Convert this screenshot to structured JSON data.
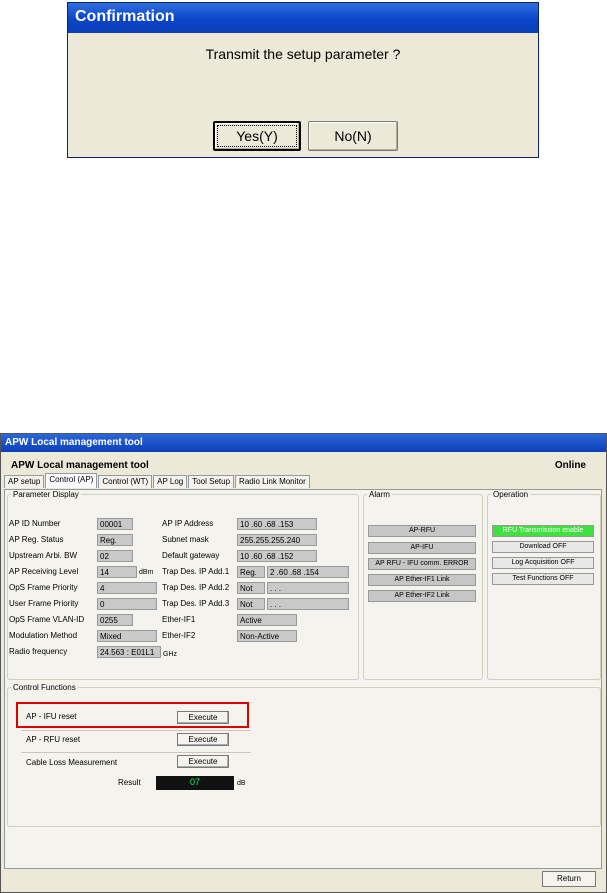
{
  "dialog": {
    "title": "Confirmation",
    "message": "Transmit the setup parameter ?",
    "yes_label": "Yes(Y)",
    "no_label": "No(N)"
  },
  "window": {
    "title": "APW Local management tool",
    "app_title": "APW Local management tool",
    "status": "Online"
  },
  "tabs": [
    "AP setup",
    "Control (AP)",
    "Control (WT)",
    "AP Log",
    "Tool Setup",
    "Radio Link Monitor"
  ],
  "param": {
    "legend": "Parameter Display",
    "left": [
      {
        "label": "AP ID Number",
        "value": "00001"
      },
      {
        "label": "AP Reg. Status",
        "value": "Reg."
      },
      {
        "label": "Upstream Arbi. BW",
        "value": "02"
      },
      {
        "label": "AP Receiving Level",
        "value": "14",
        "unit": "dBm"
      },
      {
        "label": "OpS Frame Priority",
        "value": "4"
      },
      {
        "label": "User Frame Priority",
        "value": "0"
      },
      {
        "label": "OpS Frame VLAN-ID",
        "value": "0255"
      },
      {
        "label": "Modulation Method",
        "value": "Mixed"
      },
      {
        "label": "Radio frequency",
        "value": "24.563 : E01L1",
        "unit": "GHz"
      }
    ],
    "right": [
      {
        "label": "AP IP Address",
        "value": "10 .60 .68 .153"
      },
      {
        "label": "Subnet mask",
        "value": "255.255.255.240"
      },
      {
        "label": "Default gateway",
        "value": "10 .60 .68 .152"
      },
      {
        "label": "Trap Des. IP Add.1",
        "value": "Reg.",
        "value2": "2 .60 .68 .154"
      },
      {
        "label": "Trap Des. IP Add.2",
        "value": "Not",
        "value2": ". . ."
      },
      {
        "label": "Trap Des. IP Add.3",
        "value": "Not",
        "value2": ". . ."
      },
      {
        "label": "Ether-IF1",
        "value": "Active"
      },
      {
        "label": "Ether-IF2",
        "value": "Non-Active"
      }
    ]
  },
  "alarm": {
    "legend": "Alarm",
    "items": [
      "AP-RFU",
      "AP-IFU",
      "AP RFU - IFU comm. ERROR",
      "AP Ether-IF1 Link",
      "AP Ether-IF2 Link"
    ]
  },
  "operation": {
    "legend": "Operation",
    "items": [
      "RFU Transmission enable",
      "Download OFF",
      "Log Acquisition OFF",
      "Test Functions OFF"
    ]
  },
  "control": {
    "legend": "Control Functions",
    "rows": [
      {
        "label": "AP - IFU reset",
        "button": "Execute"
      },
      {
        "label": "AP - RFU reset",
        "button": "Execute"
      },
      {
        "label": "Cable Loss Measurement",
        "button": "Execute"
      }
    ],
    "result_label": "Result",
    "result_value": "07",
    "result_unit": "dB"
  },
  "return_label": "Return",
  "colors": {
    "title_bar": "#0a3fb8",
    "highlight": "#e00000",
    "status_green": "#40e040"
  }
}
